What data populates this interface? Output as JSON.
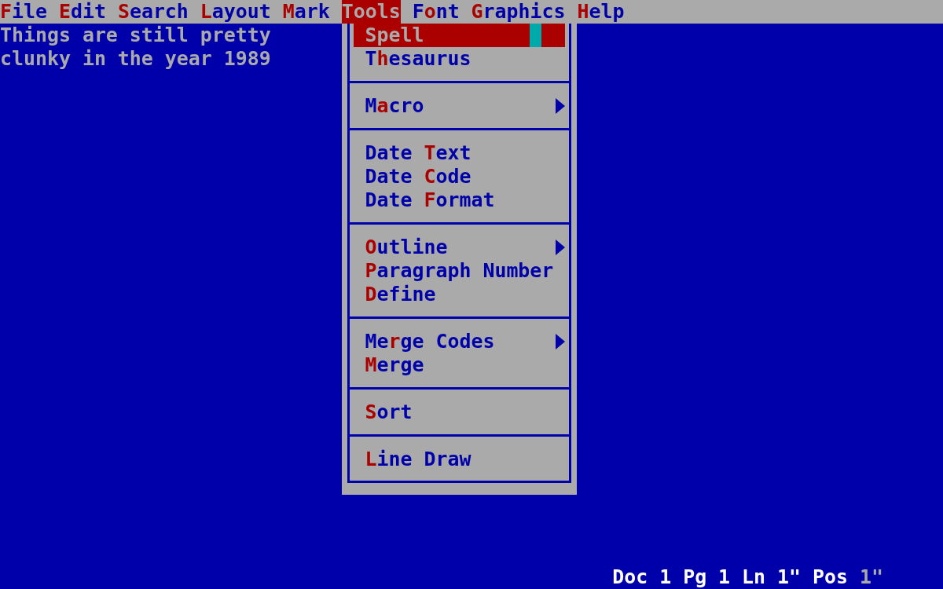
{
  "menu_bar": [
    {
      "key": "F",
      "post": "ile",
      "selected": false
    },
    {
      "key": "E",
      "post": "dit",
      "selected": false
    },
    {
      "key": "S",
      "post": "earch",
      "selected": false
    },
    {
      "key": "L",
      "post": "ayout",
      "selected": false
    },
    {
      "key": "M",
      "post": "ark",
      "selected": false
    },
    {
      "key": "T",
      "post": "ools",
      "selected": true
    },
    {
      "pre": "F",
      "key": "o",
      "post": "nt",
      "selected": false
    },
    {
      "key": "G",
      "post": "raphics",
      "selected": false
    },
    {
      "key": "H",
      "post": "elp",
      "selected": false
    }
  ],
  "document": {
    "lines": [
      "Things are still pretty",
      "clunky in the year 1989"
    ]
  },
  "tools_menu": {
    "groups": [
      {
        "items": [
          {
            "key": "S",
            "post": "pell",
            "selected": true,
            "submenu": false
          },
          {
            "pre": "T",
            "key": "h",
            "post": "esaurus",
            "selected": false,
            "submenu": false
          }
        ]
      },
      {
        "items": [
          {
            "pre": "M",
            "key": "a",
            "post": "cro",
            "selected": false,
            "submenu": true
          }
        ]
      },
      {
        "items": [
          {
            "pre": "Date ",
            "key": "T",
            "post": "ext",
            "selected": false,
            "submenu": false
          },
          {
            "pre": "Date ",
            "key": "C",
            "post": "ode",
            "selected": false,
            "submenu": false
          },
          {
            "pre": "Date ",
            "key": "F",
            "post": "ormat",
            "selected": false,
            "submenu": false
          }
        ]
      },
      {
        "items": [
          {
            "key": "O",
            "post": "utline",
            "selected": false,
            "submenu": true
          },
          {
            "key": "P",
            "post": "aragraph Number",
            "selected": false,
            "submenu": false
          },
          {
            "key": "D",
            "post": "efine",
            "selected": false,
            "submenu": false
          }
        ]
      },
      {
        "items": [
          {
            "pre": "Me",
            "key": "r",
            "post": "ge Codes",
            "selected": false,
            "submenu": true
          },
          {
            "key": "M",
            "post": "erge",
            "selected": false,
            "submenu": false
          }
        ]
      },
      {
        "items": [
          {
            "key": "S",
            "post": "ort",
            "selected": false,
            "submenu": false
          }
        ]
      },
      {
        "items": [
          {
            "key": "L",
            "post": "ine Draw",
            "selected": false,
            "submenu": false
          }
        ]
      }
    ]
  },
  "status_bar": {
    "items": [
      {
        "text": "Doc 1"
      },
      {
        "text": "Pg 1"
      },
      {
        "text": "Ln 1\""
      },
      {
        "text": "Pos"
      },
      {
        "text": "1\""
      }
    ]
  }
}
